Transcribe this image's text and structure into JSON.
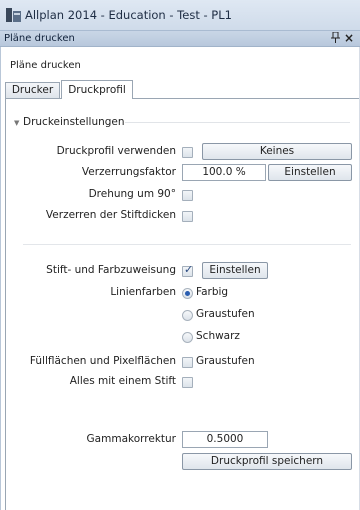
{
  "window": {
    "title": "Allplan 2014 - Education - Test - PL1"
  },
  "panel": {
    "title": "Pläne drucken",
    "pin_glyph": "ᵖ",
    "close_glyph": "×"
  },
  "section_label": "Pläne drucken",
  "tabs": [
    {
      "label": "Drucker",
      "active": false
    },
    {
      "label": "Druckprofil",
      "active": true
    }
  ],
  "group": {
    "title": "Druckeinstellungen",
    "expanded": true
  },
  "settings": {
    "use_profile": {
      "label": "Druckprofil verwenden",
      "checked": false,
      "button": "Keines"
    },
    "distortion": {
      "label": "Verzerrungsfaktor",
      "value": "100.0 %",
      "button": "Einstellen"
    },
    "rotate": {
      "label": "Drehung um 90°",
      "checked": false
    },
    "pen_distort": {
      "label": "Verzerren der Stiftdicken",
      "checked": false
    },
    "pen_color": {
      "label": "Stift- und Farbzuweisung",
      "checked": true,
      "button": "Einstellen"
    },
    "line_colors": {
      "label": "Linienfarben",
      "options": [
        "Farbig",
        "Graustufen",
        "Schwarz"
      ],
      "selected": "Farbig"
    },
    "fill_areas": {
      "label": "Füllflächen und Pixelflächen",
      "checked": false,
      "checkbox_label": "Graustufen"
    },
    "one_pen": {
      "label": "Alles mit einem Stift",
      "checked": false
    },
    "gamma": {
      "label": "Gammakorrektur",
      "value": "0.5000"
    },
    "save_profile": {
      "button": "Druckprofil speichern"
    }
  },
  "colors": {
    "accent": "#2a5db0",
    "titlebar": "#d6e0ec"
  }
}
